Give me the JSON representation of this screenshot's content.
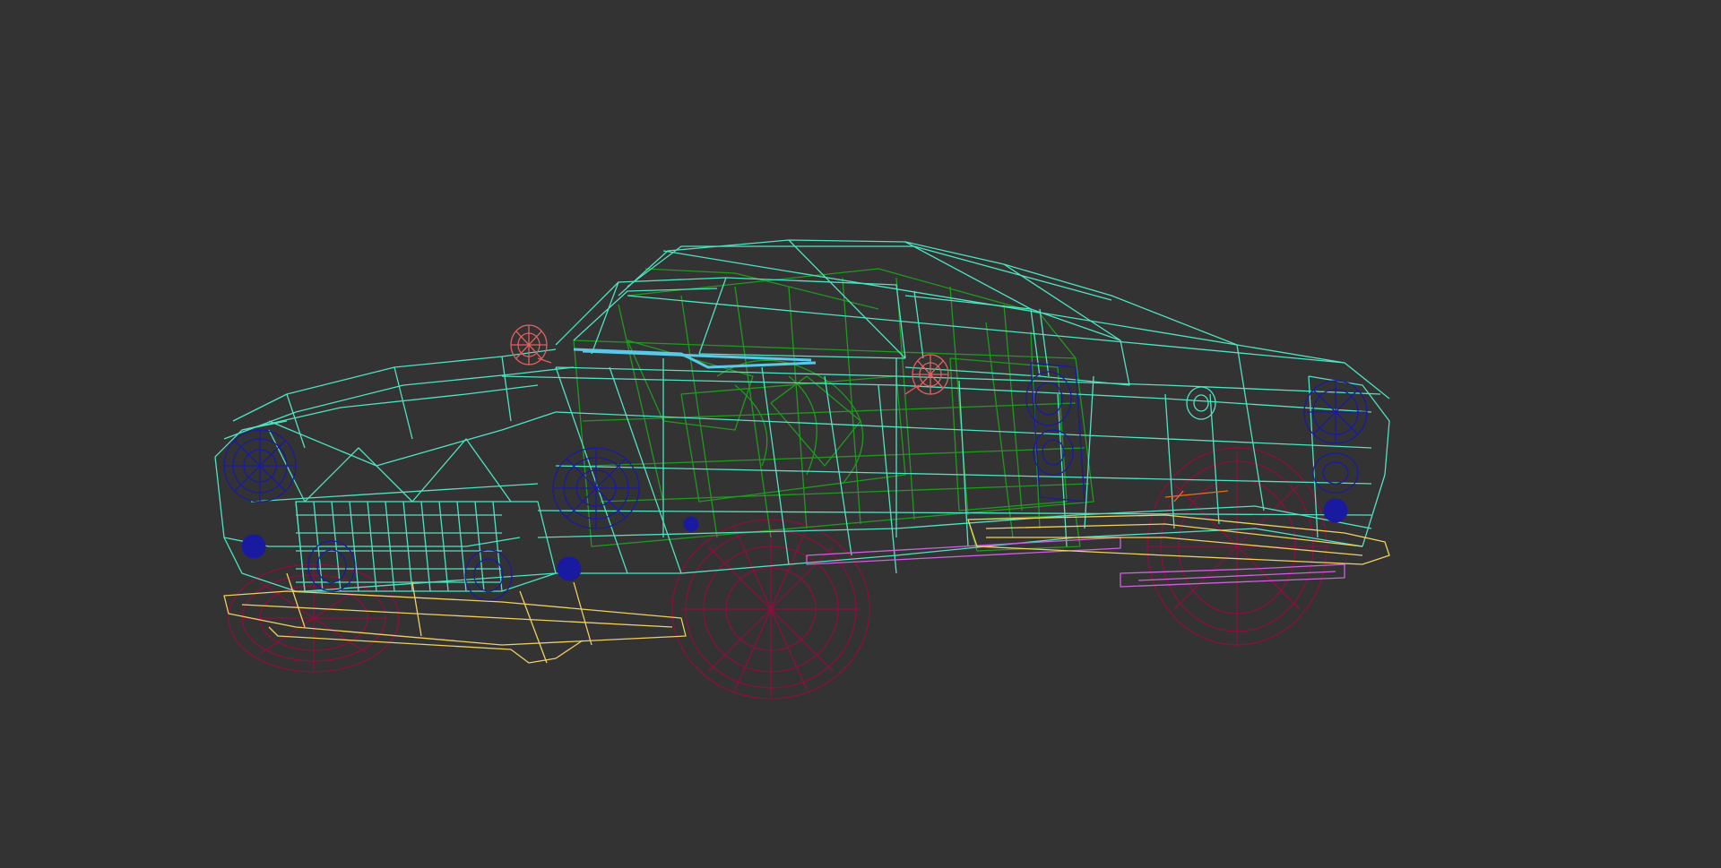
{
  "viewport": {
    "background": "#333333",
    "render_mode": "wireframe"
  },
  "model": {
    "subject": "car-wireframe",
    "colors": {
      "body": "#4fe3c1",
      "interior": "#1f9a1f",
      "wheels": "#8a1040",
      "bumpers": "#f0d060",
      "lights": "#1a1aa0",
      "mirrors": "#e06060",
      "glass": "#5ac8e8",
      "rocker": "#d060e0",
      "accent": "#e07020"
    }
  }
}
